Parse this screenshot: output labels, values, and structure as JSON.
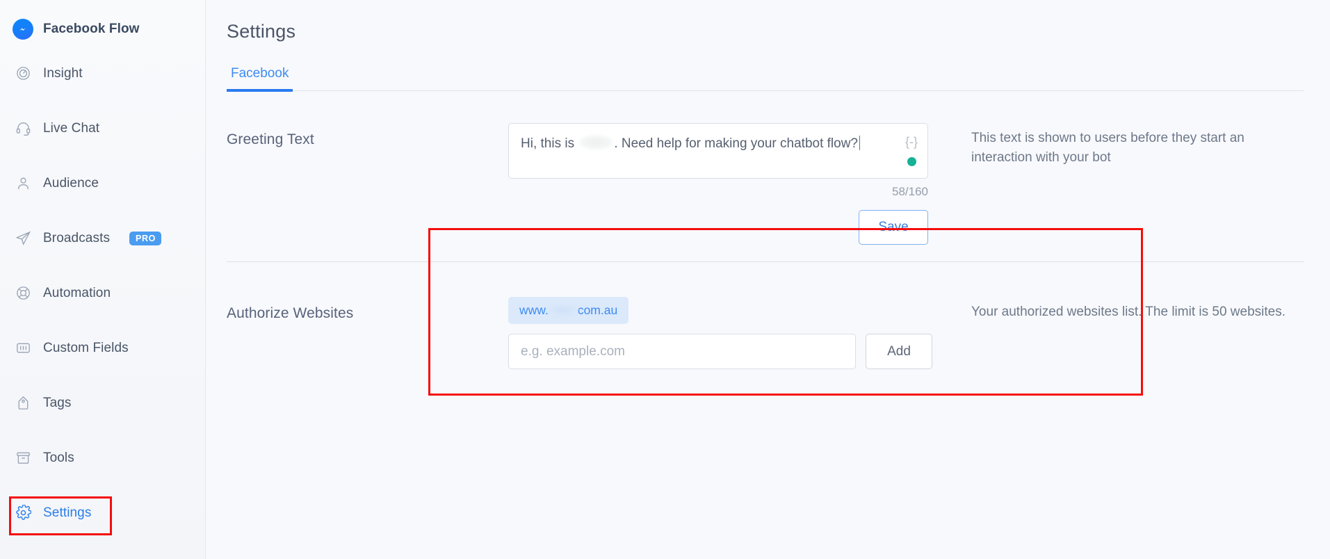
{
  "sidebar": {
    "brand": {
      "title": "Facebook Flow",
      "logo_icon": "messenger-logo-icon"
    },
    "items": [
      {
        "label": "Insight",
        "icon": "gauge-icon",
        "badge": "",
        "active": false
      },
      {
        "label": "Live Chat",
        "icon": "headset-icon",
        "badge": "",
        "active": false
      },
      {
        "label": "Audience",
        "icon": "person-icon",
        "badge": "",
        "active": false
      },
      {
        "label": "Broadcasts",
        "icon": "paper-plane-icon",
        "badge": "PRO",
        "active": false
      },
      {
        "label": "Automation",
        "icon": "lifebuoy-icon",
        "badge": "",
        "active": false
      },
      {
        "label": "Custom Fields",
        "icon": "fields-card-icon",
        "badge": "",
        "active": false
      },
      {
        "label": "Tags",
        "icon": "tag-icon",
        "badge": "",
        "active": false
      },
      {
        "label": "Tools",
        "icon": "archive-box-icon",
        "badge": "",
        "active": false
      },
      {
        "label": "Settings",
        "icon": "gear-icon",
        "badge": "",
        "active": true
      }
    ]
  },
  "main": {
    "page_title": "Settings",
    "tabs": [
      {
        "label": "Facebook",
        "active": true
      }
    ],
    "greeting": {
      "label": "Greeting Text",
      "value_before_redaction": "Hi, this is ",
      "value_after_redaction": ". Need help for making your chatbot flow?",
      "braces_icon": "curly-braces-icon",
      "status_dot": "online-status-dot",
      "char_count": "58/160",
      "save_label": "Save",
      "note": "This text is shown to users before they start an interaction with your bot"
    },
    "authorize": {
      "label": "Authorize Websites",
      "chip_prefix": "www.",
      "chip_suffix": "com.au",
      "input_placeholder": "e.g. example.com",
      "input_value": "",
      "add_label": "Add",
      "note": "Your authorized websites list. The limit is 50 websites."
    }
  },
  "colors": {
    "accent_blue": "#2a7cf0",
    "link_blue": "#3d8bf2",
    "highlight_red": "#f40d0d",
    "status_green": "#16b295",
    "pro_badge_blue": "#4a9cf0"
  }
}
